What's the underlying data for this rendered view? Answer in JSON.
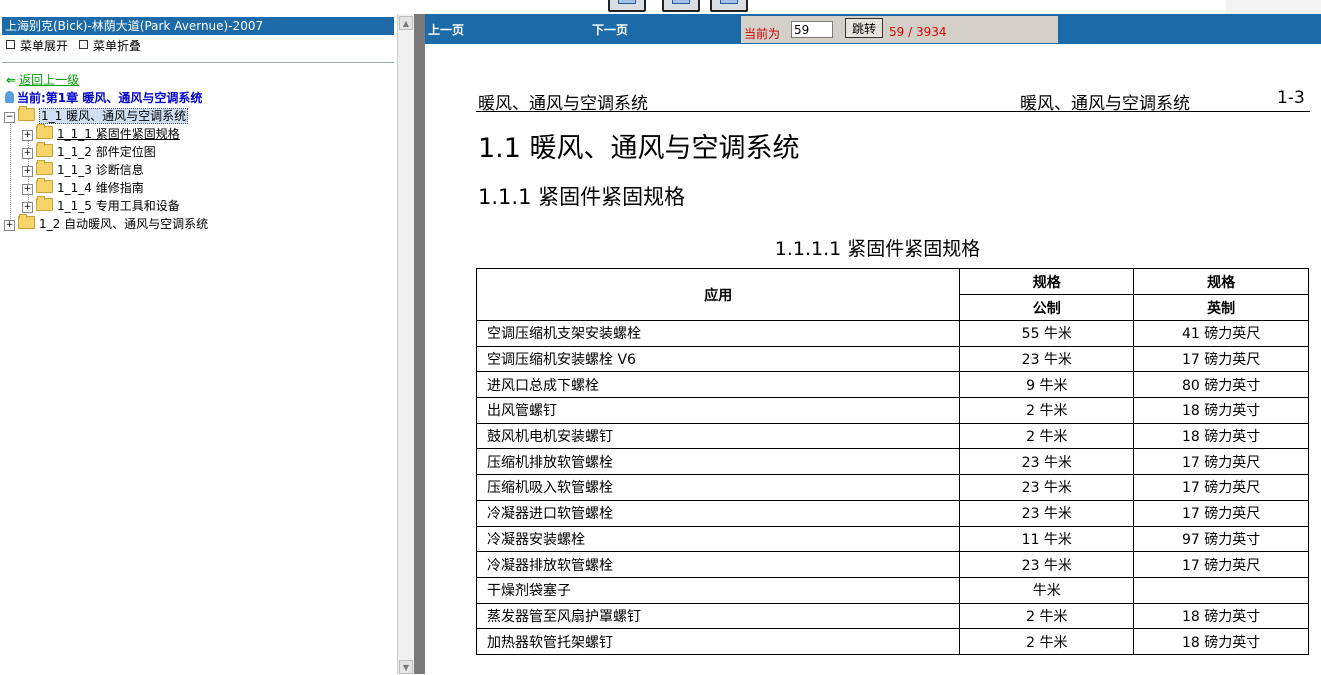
{
  "left": {
    "title": "上海别克(Bick)-林荫大道(Park Avernue)-2007",
    "menu_expand": "菜单展开",
    "menu_collapse": "菜单折叠",
    "back_link": "返回上一级",
    "current": "当前:第1章  暖风、通风与空调系统",
    "tree": [
      {
        "label": "1_1 暖风、通风与空调系统",
        "toggle": "−"
      },
      {
        "label": "1_1_1 紧固件紧固规格",
        "toggle": "+"
      },
      {
        "label": "1_1_2 部件定位图",
        "toggle": "+"
      },
      {
        "label": "1_1_3 诊断信息",
        "toggle": "+"
      },
      {
        "label": "1_1_4 维修指南",
        "toggle": "+"
      },
      {
        "label": "1_1_5 专用工具和设备",
        "toggle": "+"
      },
      {
        "label": "1_2 自动暖风、通风与空调系统",
        "toggle": "+"
      }
    ]
  },
  "nav": {
    "prev": "上一页",
    "next": "下一页",
    "current_label": "当前为",
    "page_value": "59",
    "jump": "跳转",
    "page_count": "59 / 3934"
  },
  "doc": {
    "running_head_left": "暖风、通风与空调系统",
    "running_head_right": "暖风、通风与空调系统",
    "page_number": "1-3",
    "h1": "1.1 暖风、通风与空调系统",
    "h2": "1.1.1 紧固件紧固规格",
    "h3": "1.1.1.1 紧固件紧固规格",
    "table": {
      "col_app": "应用",
      "col_spec1": "规格",
      "col_spec2": "规格",
      "sub_metric": "公制",
      "sub_imperial": "英制",
      "rows": [
        {
          "app": "空调压缩机支架安装螺栓",
          "metric": "55 牛米",
          "imperial": "41 磅力英尺"
        },
        {
          "app": "空调压缩机安装螺栓 V6",
          "metric": "23 牛米",
          "imperial": "17 磅力英尺"
        },
        {
          "app": "进风口总成下螺栓",
          "metric": "9 牛米",
          "imperial": "80 磅力英寸"
        },
        {
          "app": "出风管螺钉",
          "metric": "2 牛米",
          "imperial": "18 磅力英寸"
        },
        {
          "app": "鼓风机电机安装螺钉",
          "metric": "2 牛米",
          "imperial": "18 磅力英寸"
        },
        {
          "app": "压缩机排放软管螺栓",
          "metric": "23 牛米",
          "imperial": "17 磅力英尺"
        },
        {
          "app": "压缩机吸入软管螺栓",
          "metric": "23 牛米",
          "imperial": "17 磅力英尺"
        },
        {
          "app": "冷凝器进口软管螺栓",
          "metric": "23 牛米",
          "imperial": "17 磅力英尺"
        },
        {
          "app": "冷凝器安装螺栓",
          "metric": "11 牛米",
          "imperial": "97 磅力英寸"
        },
        {
          "app": "冷凝器排放软管螺栓",
          "metric": "23 牛米",
          "imperial": "17 磅力英尺"
        },
        {
          "app": "干燥剂袋塞子",
          "metric": "牛米",
          "imperial": ""
        },
        {
          "app": "蒸发器管至风扇护罩螺钉",
          "metric": "2 牛米",
          "imperial": "18 磅力英寸"
        },
        {
          "app": "加热器软管托架螺钉",
          "metric": "2 牛米",
          "imperial": "18 磅力英寸"
        }
      ]
    }
  },
  "colors": {
    "header_blue": "#1c6aa8",
    "red_text": "#d40000",
    "green_link": "#00a000",
    "current_blue": "#0000cc"
  }
}
